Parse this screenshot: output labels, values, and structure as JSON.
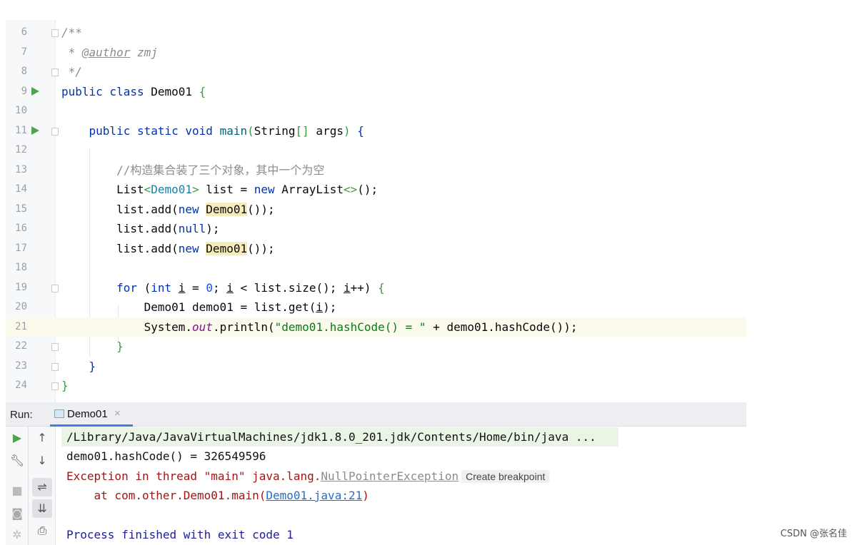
{
  "editor": {
    "lines": [
      {
        "n": "6",
        "fold": true,
        "tokens": [
          [
            "/**",
            "cm"
          ]
        ]
      },
      {
        "n": "7",
        "tokens": [
          [
            " * ",
            "cm"
          ],
          [
            "@author",
            "tag"
          ],
          [
            " zmj",
            "cm"
          ]
        ]
      },
      {
        "n": "8",
        "fold": true,
        "tokens": [
          [
            " */",
            "cm"
          ]
        ]
      },
      {
        "n": "9",
        "run": true,
        "tokens": [
          [
            "public class ",
            "kw"
          ],
          [
            "Demo01 ",
            ""
          ],
          [
            "{",
            "br"
          ]
        ]
      },
      {
        "n": "10",
        "tokens": []
      },
      {
        "n": "11",
        "run": true,
        "fold": true,
        "tokens": [
          [
            "    public static void ",
            "kw"
          ],
          [
            "main",
            "fn"
          ],
          [
            "(",
            "br"
          ],
          [
            "String",
            ""
          ],
          [
            "[]",
            "br"
          ],
          [
            " args",
            ""
          ],
          [
            ")",
            "br"
          ],
          [
            " {",
            "kw"
          ]
        ]
      },
      {
        "n": "12",
        "tokens": []
      },
      {
        "n": "13",
        "tokens": [
          [
            "        //构造集合装了三个对象，其中一个为空",
            "cmzh"
          ]
        ]
      },
      {
        "n": "14",
        "tokens": [
          [
            "        List",
            ""
          ],
          [
            "<",
            "br"
          ],
          [
            "Demo01",
            "gen"
          ],
          [
            ">",
            "br"
          ],
          [
            " list = ",
            ""
          ],
          [
            "new ",
            "kw"
          ],
          [
            "ArrayList",
            ""
          ],
          [
            "<>",
            "br"
          ],
          [
            "()",
            ""
          ],
          [
            ";",
            ""
          ]
        ]
      },
      {
        "n": "15",
        "tokens": [
          [
            "        list.add(",
            ""
          ],
          [
            "new ",
            "kw"
          ],
          [
            "Demo01",
            "hl"
          ],
          [
            "());",
            ""
          ]
        ]
      },
      {
        "n": "16",
        "tokens": [
          [
            "        list.add(",
            ""
          ],
          [
            "null",
            "kw"
          ],
          [
            ");",
            ""
          ]
        ]
      },
      {
        "n": "17",
        "tokens": [
          [
            "        list.add(",
            ""
          ],
          [
            "new ",
            "kw"
          ],
          [
            "Demo01",
            "hl"
          ],
          [
            "());",
            ""
          ]
        ]
      },
      {
        "n": "18",
        "tokens": []
      },
      {
        "n": "19",
        "fold": true,
        "tokens": [
          [
            "        ",
            ""
          ],
          [
            "for",
            "kw"
          ],
          [
            " (",
            ""
          ],
          [
            "int ",
            "kw"
          ],
          [
            "i",
            "ul"
          ],
          [
            " = ",
            ""
          ],
          [
            "0",
            "num"
          ],
          [
            "; ",
            ""
          ],
          [
            "i",
            "ul"
          ],
          [
            " < list.size(); ",
            ""
          ],
          [
            "i",
            "ul"
          ],
          [
            "++) ",
            ""
          ],
          [
            "{",
            "br"
          ]
        ]
      },
      {
        "n": "20",
        "tokens": [
          [
            "            Demo01 demo01 = list.get(",
            ""
          ],
          [
            "i",
            "ul"
          ],
          [
            ");",
            ""
          ]
        ]
      },
      {
        "n": "21",
        "current": true,
        "tokens": [
          [
            "            System.",
            ""
          ],
          [
            "out",
            "stat"
          ],
          [
            ".println(",
            ""
          ],
          [
            "\"demo01.hashCode() = \"",
            "st"
          ],
          [
            " + demo01.hashCode());",
            ""
          ]
        ]
      },
      {
        "n": "22",
        "fold": true,
        "tokens": [
          [
            "        ",
            ""
          ],
          [
            "}",
            "br"
          ]
        ]
      },
      {
        "n": "23",
        "fold": true,
        "tokens": [
          [
            "    }",
            "kw"
          ]
        ]
      },
      {
        "n": "24",
        "fold": true,
        "tokens": [
          [
            "}",
            "br"
          ]
        ]
      }
    ]
  },
  "run": {
    "label": "Run:",
    "tab": "Demo01",
    "close": "×"
  },
  "console": {
    "path": "/Library/Java/JavaVirtualMachines/jdk1.8.0_201.jdk/Contents/Home/bin/java ...",
    "hash": "demo01.hashCode() = 326549596",
    "exc_prefix": "Exception in thread \"main\" java.lang.",
    "exc_class": "NullPointerException",
    "create_bp": "Create breakpoint",
    "at_prefix": "    at com.other.Demo01.main(",
    "at_link": "Demo01.java:21",
    "at_suffix": ")",
    "finish": "Process finished with exit code 1"
  },
  "watermark": "CSDN @张名佳"
}
